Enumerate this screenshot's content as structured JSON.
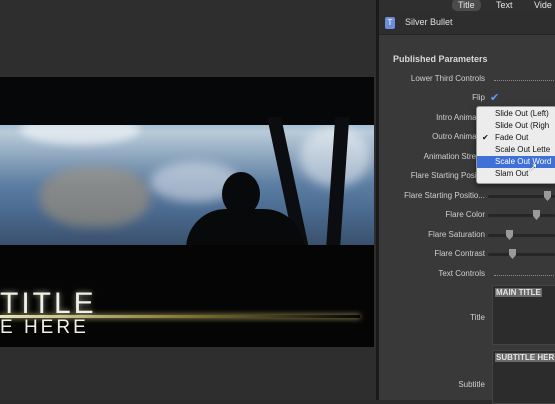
{
  "viewer": {
    "title_line1": "TITLE",
    "title_line2": "E HERE"
  },
  "inspector": {
    "tabs": [
      {
        "label": "Title",
        "active": true
      },
      {
        "label": "Text",
        "active": false
      },
      {
        "label": "Vide",
        "active": false
      }
    ],
    "header_title": "Silver Bullet",
    "section_title": "Published Parameters",
    "rows": {
      "lower_third_controls": "Lower Third Controls",
      "flip": "Flip",
      "intro_animation": "Intro Animatio",
      "outro_animation": "Outro Animatio",
      "animation_strength": "Animation Streng",
      "flare_start_pos_1": "Flare Starting Positio",
      "flare_start_pos_2": "Flare Starting Positio...",
      "flare_color": "Flare Color",
      "flare_saturation": "Flare Saturation",
      "flare_contrast": "Flare Contrast",
      "text_controls": "Text Controls",
      "title": "Title",
      "subtitle": "Subtitle"
    },
    "flip_checked": true,
    "title_text": "MAIN TITLE",
    "subtitle_text": "SUBTITLE HER",
    "slider_levels": {
      "flare_color": 0.75,
      "flare_saturation": 0.3,
      "flare_contrast": 0.35
    }
  },
  "dropdown": {
    "options": [
      {
        "label": "Slide Out (Left)",
        "checked": false,
        "selected": false
      },
      {
        "label": "Slide Out (Righ",
        "checked": false,
        "selected": false
      },
      {
        "label": "Fade Out",
        "checked": true,
        "selected": false
      },
      {
        "label": "Scale Out Lette",
        "checked": false,
        "selected": false
      },
      {
        "label": "Scale Out Word",
        "checked": false,
        "selected": true
      },
      {
        "label": "Slam Out",
        "checked": false,
        "selected": false
      }
    ]
  },
  "colors": {
    "accent": "#3e70d8",
    "checkmark": "#5aa0ff",
    "panel": "#393939"
  }
}
